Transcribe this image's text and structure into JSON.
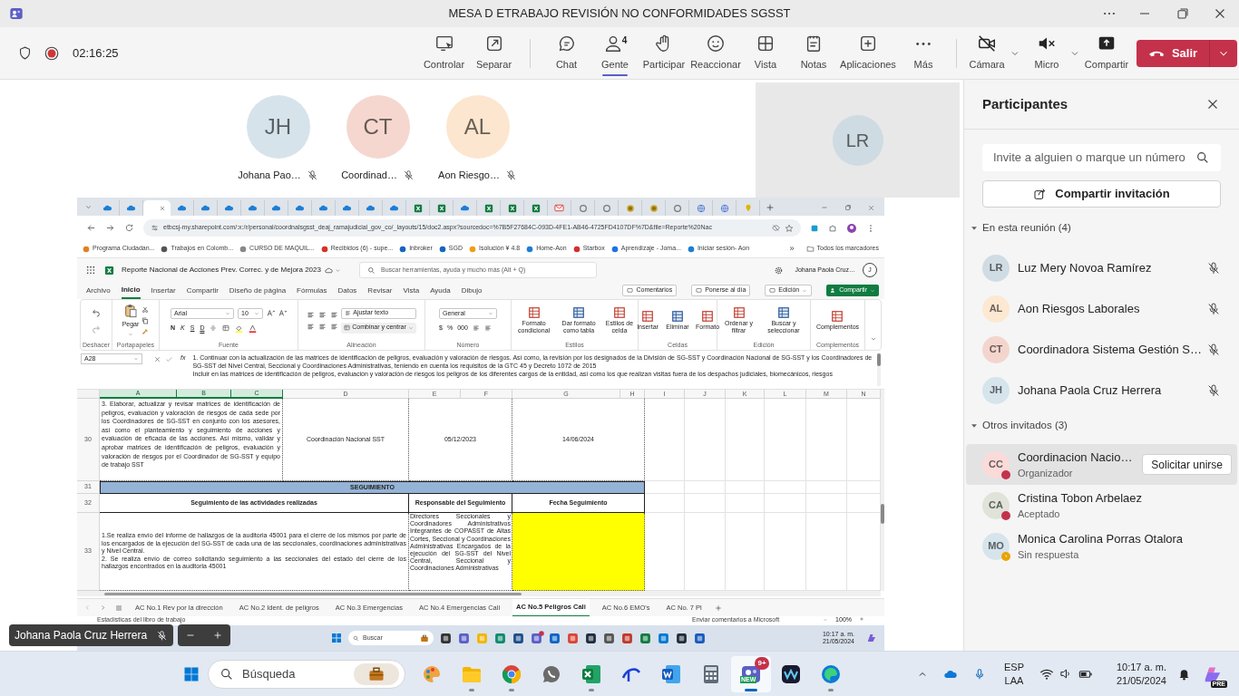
{
  "window": {
    "title": "MESA D ETRABAJO REVISIÓN NO CONFORMIDADES SGSST"
  },
  "meeting_bar": {
    "timer": "02:16:25",
    "tools": [
      {
        "label": "Controlar",
        "selected": false
      },
      {
        "label": "Separar",
        "selected": false
      },
      {
        "label": "Chat",
        "selected": false
      },
      {
        "label": "Gente",
        "badge": "4",
        "selected": true
      },
      {
        "label": "Participar",
        "selected": false
      },
      {
        "label": "Reaccionar",
        "selected": false
      },
      {
        "label": "Vista",
        "selected": false
      },
      {
        "label": "Notas",
        "selected": false
      },
      {
        "label": "Aplicaciones",
        "selected": false
      },
      {
        "label": "Más",
        "selected": false
      }
    ],
    "devices": [
      {
        "label": "Cámara",
        "menu": true
      },
      {
        "label": "Micro",
        "menu": true
      },
      {
        "label": "Compartir",
        "menu": false
      }
    ],
    "leave_button": "Salir"
  },
  "stage": {
    "avatars": [
      {
        "initials": "JH",
        "name": "Johana Pao…",
        "color": "#d6e3eb",
        "muted": true
      },
      {
        "initials": "CT",
        "name": "Coordinad…",
        "color": "#f5d7cf",
        "muted": true
      },
      {
        "initials": "AL",
        "name": "Aon Riesgo…",
        "color": "#fde6cf",
        "muted": true
      }
    ],
    "video_tile": {
      "initials": "LR",
      "color": "#cfdbe2"
    },
    "presenter": {
      "name": "Johana Paola Cruz Herrera",
      "muted": true
    }
  },
  "shared_screen": {
    "browser": {
      "tabs": [
        {
          "kind": "cloud",
          "selected": false
        },
        {
          "kind": "cloud",
          "selected": false
        },
        {
          "kind": "blank",
          "selected": true
        },
        {
          "kind": "cloud",
          "selected": false
        },
        {
          "kind": "cloud",
          "selected": false
        },
        {
          "kind": "cloud",
          "selected": false
        },
        {
          "kind": "cloud",
          "selected": false
        },
        {
          "kind": "cloud",
          "selected": false
        },
        {
          "kind": "cloud",
          "selected": false
        },
        {
          "kind": "cloud",
          "selected": false
        },
        {
          "kind": "cloud",
          "selected": false
        },
        {
          "kind": "cloud",
          "selected": false
        },
        {
          "kind": "cloud",
          "selected": false
        },
        {
          "kind": "excel",
          "selected": false
        },
        {
          "kind": "excel",
          "selected": false
        },
        {
          "kind": "cloud",
          "selected": false
        },
        {
          "kind": "excel",
          "selected": false
        },
        {
          "kind": "excel",
          "selected": false
        },
        {
          "kind": "excel",
          "selected": false
        },
        {
          "kind": "mail",
          "selected": false
        },
        {
          "kind": "ring",
          "selected": false
        },
        {
          "kind": "ring",
          "selected": false
        },
        {
          "kind": "coin",
          "selected": false
        },
        {
          "kind": "coin",
          "selected": false
        },
        {
          "kind": "ring",
          "selected": false
        },
        {
          "kind": "globe",
          "selected": false
        },
        {
          "kind": "globe",
          "selected": false
        },
        {
          "kind": "pin",
          "selected": false
        }
      ],
      "url": "etbcsj-my.sharepoint.com/:x:/r/personal/coordnalsgsst_deaj_ramajudicial_gov_co/_layouts/15/doc2.aspx?sourcedoc=%7B5F27684C-093D-4FE1-AB46-4725FD4107DF%7D&file=Reporte%20Nac",
      "bookmarks": [
        "Programa Ciudadan...",
        "Trabajos en Colomb...",
        "CURSO DE MAQUIL...",
        "Recibidos (6) - supe...",
        "Inbroker",
        "SGD",
        "Isolución ¥ 4.8",
        "Home-Aon",
        "Starbox",
        "Aprendizaje - Joma...",
        "Iniciar sesión- Aon"
      ],
      "more_bookmarks": "»",
      "all_bookmarks": "Todos los marcadores"
    },
    "excel": {
      "title": "Reporte Nacional de Acciones Prev. Correc. y de Mejora 2023",
      "search": {
        "placeholder": "Buscar herramientas, ayuda y mucho más (Alt + Q)"
      },
      "user": "Johana Paola Cruz…",
      "user_initial": "J",
      "tabs": [
        {
          "label": "Archivo",
          "selected": false
        },
        {
          "label": "Inicio",
          "selected": true
        },
        {
          "label": "Insertar",
          "selected": false
        },
        {
          "label": "Compartir",
          "selected": false
        },
        {
          "label": "Diseño de página",
          "selected": false
        },
        {
          "label": "Fórmulas",
          "selected": false
        },
        {
          "label": "Datos",
          "selected": false
        },
        {
          "label": "Revisar",
          "selected": false
        },
        {
          "label": "Vista",
          "selected": false
        },
        {
          "label": "Ayuda",
          "selected": false
        },
        {
          "label": "Dibujo",
          "selected": false
        }
      ],
      "actions": [
        "Comentarios",
        "Ponerse al día",
        "Edición",
        "Compartir"
      ],
      "ribbon": [
        {
          "kind": "undo",
          "label": "Deshacer"
        },
        {
          "kind": "clipboard",
          "label": "Portapapeles",
          "buttons": [
            "Pegar"
          ]
        },
        {
          "kind": "font",
          "label": "Fuente",
          "font": "Arial",
          "size": "10",
          "buttons": [
            "N",
            "K",
            "S",
            "D"
          ]
        },
        {
          "kind": "align",
          "label": "Alineación",
          "buttons": [
            "Ajustar texto",
            "Combinar y centrar"
          ]
        },
        {
          "kind": "number",
          "label": "Número",
          "format": "General",
          "buttons": [
            "$",
            "%",
            "000"
          ]
        },
        {
          "kind": "big",
          "label": "Estilos",
          "buttons": [
            "Formato condicional",
            "Dar formato como tabla",
            "Estilos de celda"
          ]
        },
        {
          "kind": "big",
          "label": "Celdas",
          "buttons": [
            "Insertar",
            "Eliminar",
            "Formato"
          ]
        },
        {
          "kind": "big",
          "label": "Edición",
          "buttons": [
            "Ordenar y filtrar",
            "Buscar y seleccionar"
          ]
        },
        {
          "kind": "big",
          "label": "Complementos",
          "buttons": [
            "Complementos"
          ]
        }
      ],
      "name_box": "A28",
      "fx": "fx",
      "formula": [
        "1.  Continuar con la actualización de las matrices de identificación de peligros, evaluación y valoración de riesgos. Así como, la revisión por los designados de la División de SG-SST y Coordinación Nacional de SG-SST y los Coordinadores de SG-SST del Nivel Central, Seccional y Coordinaciones Administrativas, teniendo en cuenta los requisitos de la GTC 45 y Decreto 1072 de 2015",
        "Incluir en las matrices de identificación de peligros, evaluación y valoración de riesgos los peligros de los diferentes cargos de la entidad, así como los que realizan visitas fuera de los despachos judiciales, biomecánicos, riesgos"
      ],
      "column_headers": [
        {
          "label": "A",
          "selected": true
        },
        {
          "label": "B",
          "selected": true
        },
        {
          "label": "C",
          "selected": true
        },
        {
          "label": "D",
          "selected": false
        },
        {
          "label": "E",
          "selected": false
        },
        {
          "label": "F",
          "selected": false
        },
        {
          "label": "G",
          "selected": false
        },
        {
          "label": "H",
          "selected": false
        },
        {
          "label": "I",
          "selected": false
        },
        {
          "label": "J",
          "selected": false
        },
        {
          "label": "K",
          "selected": false
        },
        {
          "label": "L",
          "selected": false
        },
        {
          "label": "M",
          "selected": false
        },
        {
          "label": "N",
          "selected": false
        }
      ],
      "task_row": {
        "number": "30",
        "cells": [
          {
            "text": "3.  Elaborar, actualizar y revisar matrices de identificación de  peligros, evaluación y valoración de riesgos de  cada sede por los Coordinadores de SG-SST en conjunto con los asesores, así como el planteamiento y seguimiento de acciones y evaluación de eficacia de las acciones. Así mismo, validar y aprobar matrices de identificación de peligros, evaluación y valoración de riesgos por el Coordinador de SG-SST y equipo de trabajo SST"
          },
          {
            "text": "Coordinación Nacional SST"
          },
          {
            "text": "05/12/2023"
          },
          {
            "text": "14/06/2024"
          }
        ]
      },
      "section_band": {
        "number": "31",
        "text": "SEGUIMIENTO"
      },
      "followup_table": {
        "header": {
          "number": "32",
          "cells": [
            {
              "text": "Seguimiento de las actividades realizadas"
            },
            {
              "text": "Responsable del Seguimiento"
            },
            {
              "text": "Fecha Seguimiento"
            }
          ]
        },
        "rows": [
          {
            "number": "33",
            "cells": [
              {
                "text": "1.Se realiza envío del informe de hallazgos de la auditoria 45001 para el cierre de los mismos por parte de los encargados de la ejecución del SG-SST de cada una de las seccionales, coordinaciones administrativas y Nivel Central.\n2. Se realiza envío de correo solicitando seguimiento a las seccionales del estado del cierre de los hallazgos encontrados en la auditoria 45001"
              },
              {
                "text": "Directores Seccionales y Coordinadores Administrativos Integrantes de COPASST de Altas Cortes, Seccional y Coordinaciones Administrativas Encargados de la ejecución del SG-SST del Nivel Central, Seccional y Coordinaciones Administrativas"
              },
              {
                "color": "#ffff00"
              }
            ]
          }
        ]
      },
      "sheets": [
        {
          "label": "AC No.1 Rev por la dirección",
          "selected": false
        },
        {
          "label": "AC No.2 Ident. de peligros",
          "selected": false
        },
        {
          "label": "AC No.3 Emergencias",
          "selected": false
        },
        {
          "label": "AC No.4 Emergencias Cali",
          "selected": false
        },
        {
          "label": "AC No.5 Peligros Cali",
          "selected": true
        },
        {
          "label": "AC No.6 EMO's",
          "selected": false
        },
        {
          "label": "AC No. 7 Pl",
          "selected": false
        }
      ],
      "status_left": "Estadísticas del libro de trabajo",
      "feedback": "Enviar comentarios a Microsoft",
      "zoom": "100%"
    },
    "taskbar": {
      "search_placeholder": "Buscar",
      "time": "10:17 a. m.",
      "date": "21/05/2024"
    }
  },
  "participants_panel": {
    "title": "Participantes",
    "search": {
      "placeholder": "Invite a alguien o marque un número"
    },
    "share_button": "Compartir invitación",
    "sections": [
      {
        "label": "En esta reunión (4)",
        "expanded": true,
        "people": [
          {
            "initials": "LR",
            "name": "Luz Mery Novoa Ramírez",
            "color": "#d0dce3",
            "muted": true,
            "selected": false
          },
          {
            "initials": "AL",
            "name": "Aon Riesgos Laborales",
            "color": "#fde8d2",
            "muted": true,
            "selected": false
          },
          {
            "initials": "CT",
            "name": "Coordinadora Sistema Gestión S…",
            "color": "#f4d5cd",
            "muted": true,
            "selected": false
          },
          {
            "initials": "JH",
            "name": "Johana Paola Cruz Herrera",
            "color": "#d6e4ec",
            "muted": true,
            "selected": false
          }
        ]
      },
      {
        "label": "Otros invitados (3)",
        "expanded": true,
        "people": [
          {
            "initials": "CC",
            "name": "Coordinacion Nacio…",
            "role": "Organizador",
            "status": {
              "kind": "busy",
              "color": "#c4314b"
            },
            "color": "#fadbd9",
            "selected": true,
            "action": "Solicitar unirse"
          },
          {
            "initials": "CA",
            "name": "Cristina Tobon Arbelaez",
            "role": "Aceptado",
            "status": {
              "kind": "busy",
              "color": "#c4314b"
            },
            "color": "#dfe3d8",
            "selected": false
          },
          {
            "initials": "MO",
            "name": "Monica Carolina Porras Otalora",
            "role": "Sin respuesta",
            "status": {
              "kind": "pending",
              "color": "#eaa300"
            },
            "color": "#d6e4ec",
            "selected": false
          }
        ]
      }
    ]
  },
  "taskbar": {
    "search_placeholder": "Búsqueda",
    "apps": [
      {
        "kind": "paint",
        "running": false,
        "selected": false
      },
      {
        "kind": "folder",
        "running": true,
        "selected": false
      },
      {
        "kind": "chrome",
        "running": true,
        "selected": false
      },
      {
        "kind": "whatsapp",
        "running": false,
        "selected": false
      },
      {
        "kind": "excel",
        "running": true,
        "selected": false
      },
      {
        "kind": "disney",
        "running": false,
        "selected": false
      },
      {
        "kind": "word",
        "running": false,
        "selected": false
      },
      {
        "kind": "calculator",
        "running": false,
        "selected": false
      },
      {
        "kind": "teams",
        "running": true,
        "selected": true,
        "badge": "9+",
        "tag": "NEW"
      },
      {
        "kind": "wave",
        "running": false,
        "selected": false
      },
      {
        "kind": "edge",
        "running": true,
        "selected": false
      }
    ],
    "language": "ESP",
    "layout": "LAA",
    "time": "10:17 a. m.",
    "date": "21/05/2024",
    "copilot_tag": "PRE"
  }
}
